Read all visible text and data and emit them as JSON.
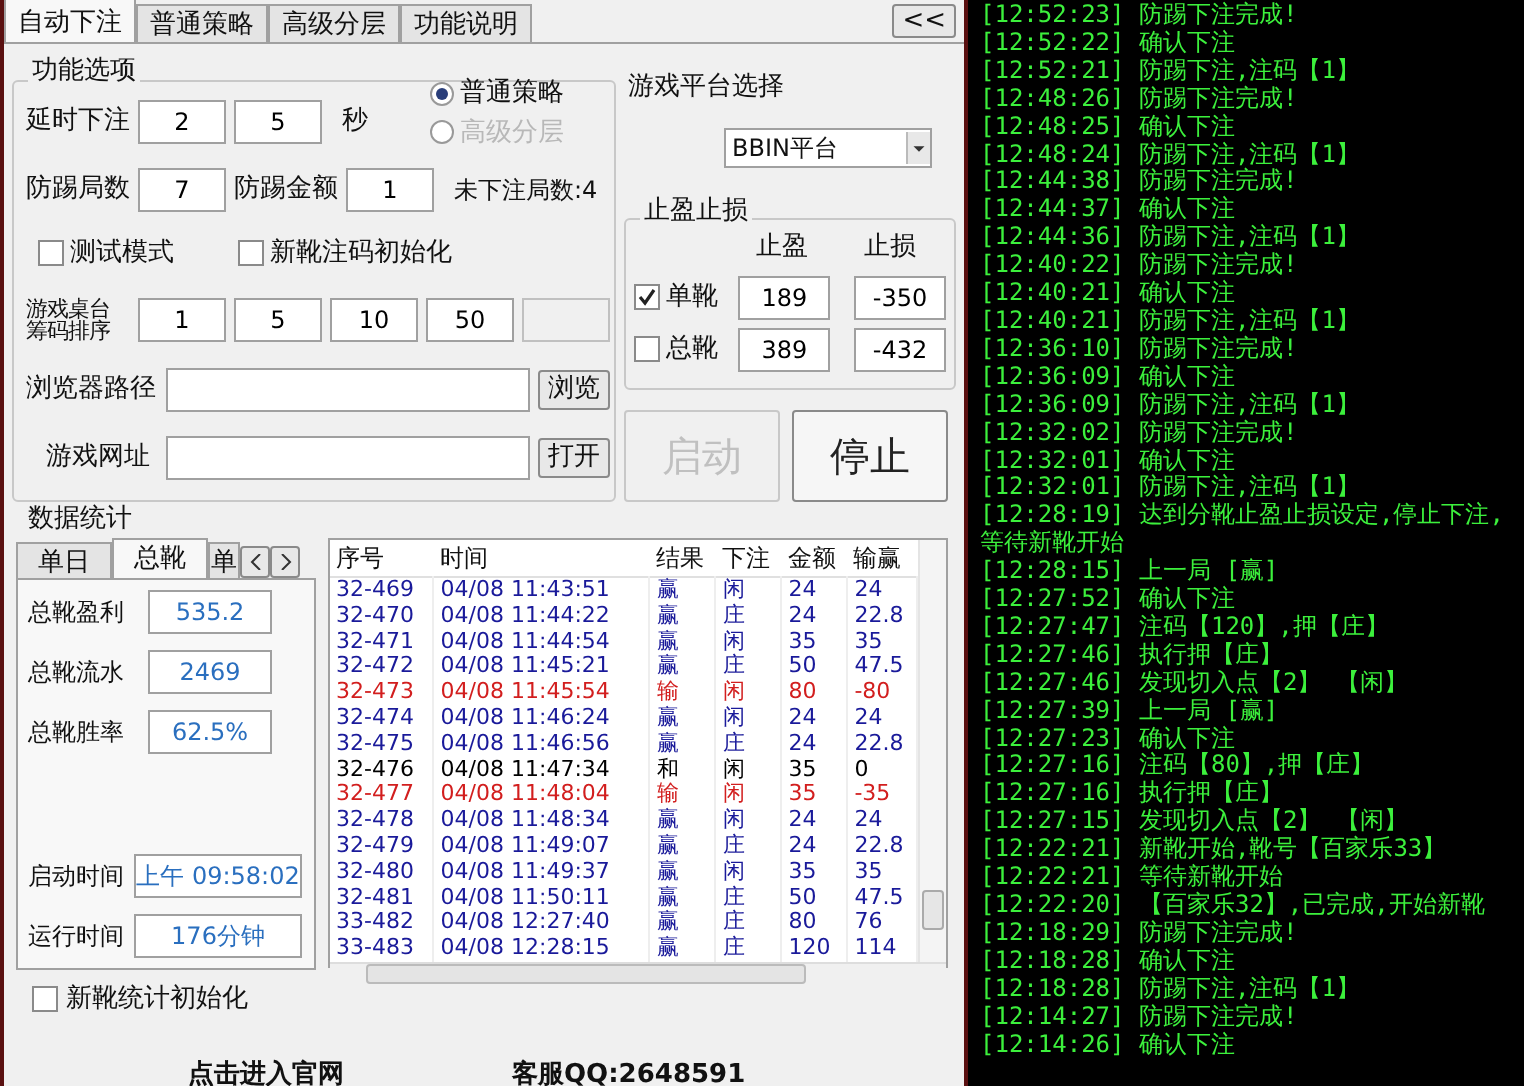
{
  "tabs": [
    {
      "label": "自动下注",
      "selected": true
    },
    {
      "label": "普通策略",
      "selected": false
    },
    {
      "label": "高级分层",
      "selected": false
    },
    {
      "label": "功能说明",
      "selected": false
    }
  ],
  "collapse_button": "<<",
  "options": {
    "title": "功能选项",
    "delay": {
      "label": "延时下注",
      "from": "2",
      "to": "5",
      "unit": "秒"
    },
    "strategy": [
      {
        "label": "普通策略",
        "selected": true,
        "disabled": false
      },
      {
        "label": "高级分层",
        "selected": false,
        "disabled": true
      }
    ],
    "guard": {
      "rounds_label": "防踢局数",
      "rounds": "7",
      "amount_label": "防踢金额",
      "amount": "1",
      "status": "未下注局数:4"
    },
    "checkboxes": [
      {
        "label": "测试模式",
        "checked": false
      },
      {
        "label": "新靴注码初始化",
        "checked": false
      }
    ],
    "chips": {
      "label": "游戏桌台筹码排序",
      "values": [
        "1",
        "5",
        "10",
        "50"
      ]
    },
    "browser": {
      "label": "浏览器路径",
      "button": "浏览"
    },
    "url": {
      "label": "游戏网址",
      "button": "打开"
    }
  },
  "platform": {
    "label": "游戏平台选择",
    "value": "BBIN平台"
  },
  "limits": {
    "title": "止盈止损",
    "columns": [
      "止盈",
      "止损"
    ],
    "rows": [
      {
        "label": "单靴",
        "checked": true,
        "take_profit": "189",
        "stop_loss": "-350"
      },
      {
        "label": "总靴",
        "checked": false,
        "take_profit": "389",
        "stop_loss": "-432"
      }
    ]
  },
  "actions": [
    {
      "label": "启动",
      "disabled": true
    },
    {
      "label": "停止",
      "disabled": false
    }
  ],
  "stats": {
    "title": "数据统计",
    "tabs": [
      {
        "label": "单日",
        "selected": false
      },
      {
        "label": "总靴",
        "selected": true
      },
      {
        "label": "单",
        "selected": false
      }
    ],
    "fields": [
      {
        "label": "总靴盈利",
        "value": "535.2"
      },
      {
        "label": "总靴流水",
        "value": "2469"
      },
      {
        "label": "总靴胜率",
        "value": "62.5%"
      }
    ],
    "times": [
      {
        "label": "启动时间",
        "value": "上午 09:58:02"
      },
      {
        "label": "运行时间",
        "value": "176分钟"
      }
    ]
  },
  "table": {
    "columns": [
      "序号",
      "时间",
      "结果",
      "下注",
      "金额",
      "输赢"
    ],
    "rows": [
      {
        "kind": "win",
        "cells": [
          "32-469",
          "04/08 11:43:51",
          "赢",
          "闲",
          "24",
          "24"
        ]
      },
      {
        "kind": "win",
        "cells": [
          "32-470",
          "04/08 11:44:22",
          "赢",
          "庄",
          "24",
          "22.8"
        ]
      },
      {
        "kind": "win",
        "cells": [
          "32-471",
          "04/08 11:44:54",
          "赢",
          "闲",
          "35",
          "35"
        ]
      },
      {
        "kind": "win",
        "cells": [
          "32-472",
          "04/08 11:45:21",
          "赢",
          "庄",
          "50",
          "47.5"
        ]
      },
      {
        "kind": "lose",
        "cells": [
          "32-473",
          "04/08 11:45:54",
          "输",
          "闲",
          "80",
          "-80"
        ]
      },
      {
        "kind": "win",
        "cells": [
          "32-474",
          "04/08 11:46:24",
          "赢",
          "闲",
          "24",
          "24"
        ]
      },
      {
        "kind": "win",
        "cells": [
          "32-475",
          "04/08 11:46:56",
          "赢",
          "庄",
          "24",
          "22.8"
        ]
      },
      {
        "kind": "tie",
        "cells": [
          "32-476",
          "04/08 11:47:34",
          "和",
          "闲",
          "35",
          "0"
        ]
      },
      {
        "kind": "lose",
        "cells": [
          "32-477",
          "04/08 11:48:04",
          "输",
          "闲",
          "35",
          "-35"
        ]
      },
      {
        "kind": "win",
        "cells": [
          "32-478",
          "04/08 11:48:34",
          "赢",
          "闲",
          "24",
          "24"
        ]
      },
      {
        "kind": "win",
        "cells": [
          "32-479",
          "04/08 11:49:07",
          "赢",
          "庄",
          "24",
          "22.8"
        ]
      },
      {
        "kind": "win",
        "cells": [
          "32-480",
          "04/08 11:49:37",
          "赢",
          "闲",
          "35",
          "35"
        ]
      },
      {
        "kind": "win",
        "cells": [
          "32-481",
          "04/08 11:50:11",
          "赢",
          "庄",
          "50",
          "47.5"
        ]
      },
      {
        "kind": "win",
        "cells": [
          "33-482",
          "04/08 12:27:40",
          "赢",
          "庄",
          "80",
          "76"
        ]
      },
      {
        "kind": "win",
        "cells": [
          "33-483",
          "04/08 12:28:15",
          "赢",
          "庄",
          "120",
          "114"
        ]
      }
    ]
  },
  "reset_stats": {
    "label": "新靴统计初始化",
    "checked": false
  },
  "footer": {
    "link": "点击进入官网",
    "support": "客服QQ:2648591"
  },
  "log": [
    {
      "time": "[12:52:23]",
      "text": "防踢下注完成!"
    },
    {
      "time": "[12:52:22]",
      "text": "确认下注"
    },
    {
      "time": "[12:52:21]",
      "text": "防踢下注,注码【1】"
    },
    {
      "time": "[12:48:26]",
      "text": "防踢下注完成!"
    },
    {
      "time": "[12:48:25]",
      "text": "确认下注"
    },
    {
      "time": "[12:48:24]",
      "text": "防踢下注,注码【1】"
    },
    {
      "time": "[12:44:38]",
      "text": "防踢下注完成!"
    },
    {
      "time": "[12:44:37]",
      "text": "确认下注"
    },
    {
      "time": "[12:44:36]",
      "text": "防踢下注,注码【1】"
    },
    {
      "time": "[12:40:22]",
      "text": "防踢下注完成!"
    },
    {
      "time": "[12:40:21]",
      "text": "确认下注"
    },
    {
      "time": "[12:40:21]",
      "text": "防踢下注,注码【1】"
    },
    {
      "time": "[12:36:10]",
      "text": "防踢下注完成!"
    },
    {
      "time": "[12:36:09]",
      "text": "确认下注"
    },
    {
      "time": "[12:36:09]",
      "text": "防踢下注,注码【1】"
    },
    {
      "time": "[12:32:02]",
      "text": "防踢下注完成!"
    },
    {
      "time": "[12:32:01]",
      "text": "确认下注"
    },
    {
      "time": "[12:32:01]",
      "text": "防踢下注,注码【1】"
    },
    {
      "time": "[12:28:19]",
      "text": "达到分靴止盈止损设定,停止下注,等待新靴开始"
    },
    {
      "time": "[12:28:15]",
      "text": "上一局 [赢]"
    },
    {
      "time": "[12:27:52]",
      "text": "确认下注"
    },
    {
      "time": "[12:27:47]",
      "text": "注码【120】,押【庄】"
    },
    {
      "time": "[12:27:46]",
      "text": "执行押【庄】"
    },
    {
      "time": "[12:27:46]",
      "text": "发现切入点【2】 【闲】"
    },
    {
      "time": "[12:27:39]",
      "text": "上一局 [赢]"
    },
    {
      "time": "[12:27:23]",
      "text": "确认下注"
    },
    {
      "time": "[12:27:16]",
      "text": "注码【80】,押【庄】"
    },
    {
      "time": "[12:27:16]",
      "text": "执行押【庄】"
    },
    {
      "time": "[12:27:15]",
      "text": "发现切入点【2】 【闲】"
    },
    {
      "time": "[12:22:21]",
      "text": "新靴开始,靴号【百家乐33】"
    },
    {
      "time": "[12:22:21]",
      "text": "等待新靴开始"
    },
    {
      "time": "[12:22:20]",
      "text": "【百家乐32】,已完成,开始新靴"
    },
    {
      "time": "[12:18:29]",
      "text": "防踢下注完成!"
    },
    {
      "time": "[12:18:28]",
      "text": "确认下注"
    },
    {
      "time": "[12:18:28]",
      "text": "防踢下注,注码【1】"
    },
    {
      "time": "[12:14:27]",
      "text": "防踢下注完成!"
    },
    {
      "time": "[12:14:26]",
      "text": "确认下注"
    }
  ]
}
